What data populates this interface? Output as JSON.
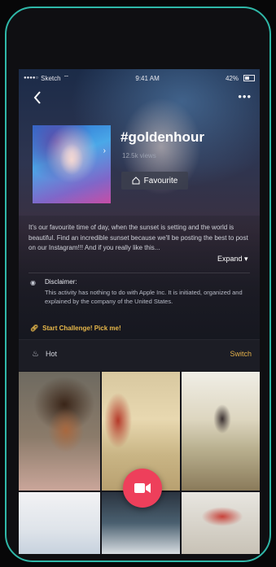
{
  "status_bar": {
    "carrier": "Sketch",
    "time": "9:41 AM",
    "battery": "42%"
  },
  "nav": {
    "back_icon": "chevron-left-icon",
    "more_icon": "more-horizontal-icon"
  },
  "challenge_header": {
    "title": "#goldenhour",
    "views": "12.5k views",
    "favourite_label": "Favourite"
  },
  "description": {
    "text": "It's our favourite time of day, when the sunset is setting and the world is beautiful. Find an incredible sunset because we'll be posting the best to post on our Instagram!!! And if you really like this...",
    "expand_label": "Expand ▾"
  },
  "disclaimer": {
    "title": "Disclaimer:",
    "text": "This activity has nothing to do with Apple Inc. It is initiated, organized and explained by the company of the United States."
  },
  "challenge_link": {
    "label": "Start Challenge! Pick me!"
  },
  "feed": {
    "section_label": "Hot",
    "switch_label": "Switch"
  },
  "colors": {
    "accent_gold": "#e3b04a",
    "record_red": "#ee3f5b",
    "frame_teal": "#2fb8a8"
  }
}
